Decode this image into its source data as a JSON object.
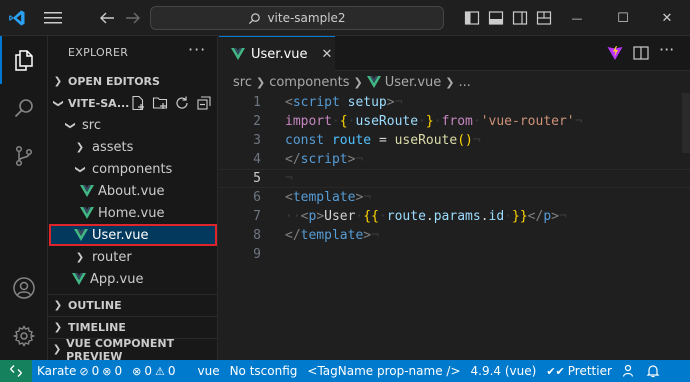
{
  "titlebar": {
    "search_text": "vite-sample2",
    "minimize_glyph": "—",
    "maximize_glyph": "☐",
    "close_glyph": "✕"
  },
  "explorer": {
    "title": "EXPLORER",
    "more_glyph": "···",
    "open_editors_label": "OPEN EDITORS",
    "project_label": "VITE-SA...",
    "outline_label": "OUTLINE",
    "timeline_label": "TIMELINE",
    "vue_preview_label": "VUE COMPONENT PREVIEW",
    "tree": [
      {
        "label": "src",
        "kind": "folder-open"
      },
      {
        "label": "assets",
        "kind": "folder-closed"
      },
      {
        "label": "components",
        "kind": "folder-open"
      },
      {
        "label": "About.vue",
        "kind": "vue"
      },
      {
        "label": "Home.vue",
        "kind": "vue"
      },
      {
        "label": "User.vue",
        "kind": "vue",
        "selected": true
      },
      {
        "label": "router",
        "kind": "folder-closed"
      },
      {
        "label": "App.vue",
        "kind": "vue"
      }
    ]
  },
  "editor": {
    "tab_label": "User.vue",
    "tab_close_glyph": "✕",
    "breadcrumb": [
      "src",
      "components",
      "User.vue",
      "..."
    ],
    "current_line": 5,
    "line_numbers": [
      "1",
      "2",
      "3",
      "4",
      "5",
      "6",
      "7",
      "8",
      "9"
    ]
  },
  "statusbar": {
    "remote_icon": "remote-icon",
    "karate": "Karate",
    "errors_a": "0",
    "warnings_a": "0",
    "errors_b": "0",
    "warnings_b": "0",
    "language": "vue",
    "tsconfig": "No tsconfig",
    "tagname": "<TagName prop-name />",
    "version": "4.9.4 (vue)",
    "prettier": "Prettier"
  },
  "colors": {
    "accent": "#0078d4",
    "statusbar": "#007acc",
    "vue_green": "#41b883",
    "highlight_border": "#e0242b"
  }
}
